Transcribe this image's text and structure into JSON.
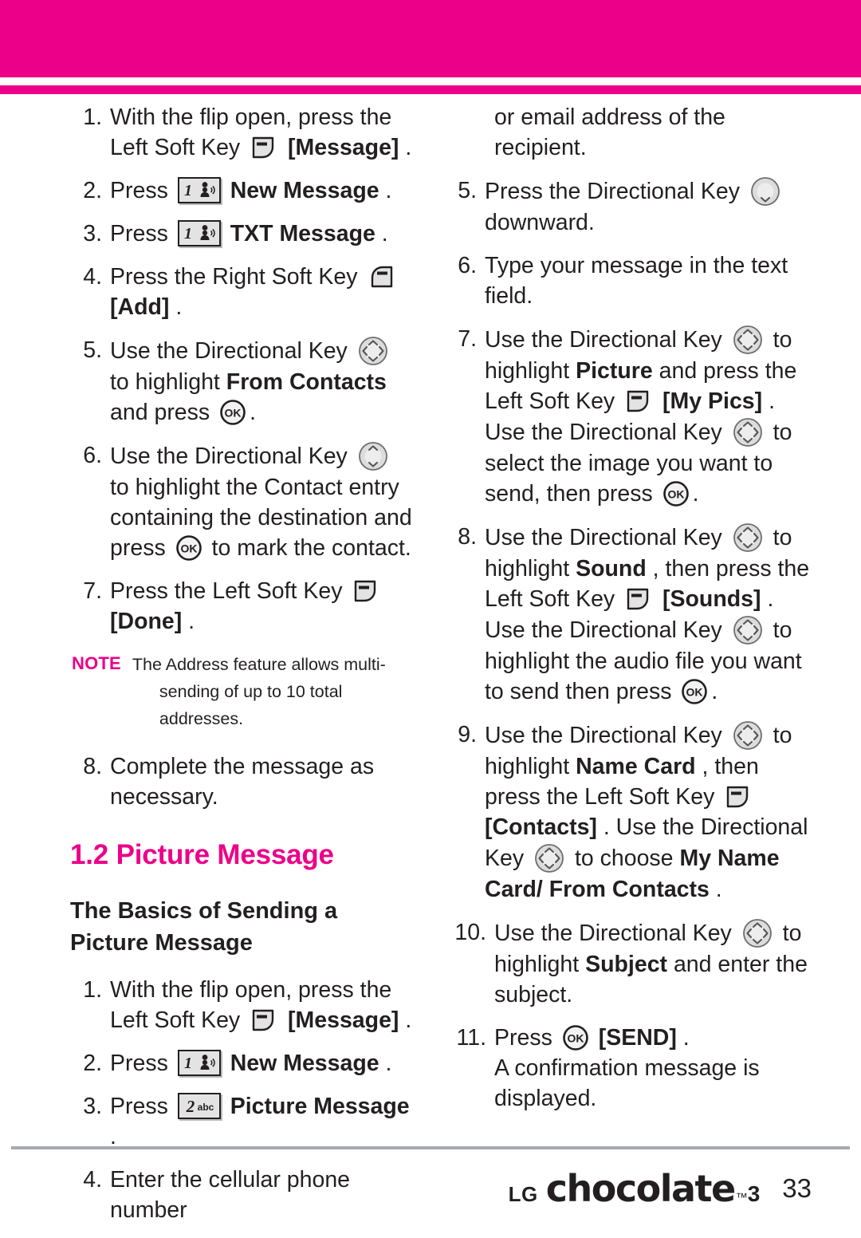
{
  "page": {
    "number": "33",
    "accent_color": "#ec0089",
    "text_color": "#231f20",
    "rule_color": "#a9aaae"
  },
  "footer": {
    "logo_lg": "LG",
    "logo_word": "chocolate",
    "logo_tm": "™",
    "logo_superscript": "3",
    "page_number": "33"
  },
  "left_column": {
    "txt_message_steps": [
      {
        "num": "1.",
        "parts": [
          {
            "t": "text",
            "v": "With the flip open, press the Left Soft Key"
          },
          {
            "t": "icon",
            "v": "left-soft-key"
          },
          {
            "t": "bold",
            "v": "[Message]"
          },
          {
            "t": "text",
            "v": "."
          }
        ]
      },
      {
        "num": "2.",
        "parts": [
          {
            "t": "text",
            "v": "Press"
          },
          {
            "t": "icon",
            "v": "key-1-voicemail"
          },
          {
            "t": "bold",
            "v": "New Message"
          },
          {
            "t": "text",
            "v": "."
          }
        ]
      },
      {
        "num": "3.",
        "parts": [
          {
            "t": "text",
            "v": "Press"
          },
          {
            "t": "icon",
            "v": "key-1-voicemail"
          },
          {
            "t": "bold",
            "v": "TXT Message"
          },
          {
            "t": "text",
            "v": "."
          }
        ]
      },
      {
        "num": "4.",
        "parts": [
          {
            "t": "text",
            "v": "Press the Right Soft Key"
          },
          {
            "t": "icon",
            "v": "right-soft-key"
          },
          {
            "t": "bold",
            "v": "[Add]"
          },
          {
            "t": "text",
            "v": "."
          }
        ]
      },
      {
        "num": "5.",
        "parts": [
          {
            "t": "text",
            "v": "Use the Directional Key"
          },
          {
            "t": "icon",
            "v": "directional-key-4way"
          },
          {
            "t": "text",
            "v": "to highlight"
          },
          {
            "t": "bold",
            "v": "From Contacts"
          },
          {
            "t": "text",
            "v": "and press"
          },
          {
            "t": "icon",
            "v": "ok-key"
          },
          {
            "t": "text",
            "v": "."
          }
        ]
      },
      {
        "num": "6.",
        "parts": [
          {
            "t": "text",
            "v": "Use the Directional Key"
          },
          {
            "t": "icon",
            "v": "directional-key-updown"
          },
          {
            "t": "text",
            "v": "to highlight the Contact entry containing the destination and press"
          },
          {
            "t": "icon",
            "v": "ok-key"
          },
          {
            "t": "text",
            "v": "to mark the contact."
          }
        ]
      },
      {
        "num": "7.",
        "parts": [
          {
            "t": "text",
            "v": "Press the Left Soft Key"
          },
          {
            "t": "icon",
            "v": "left-soft-key"
          },
          {
            "t": "bold",
            "v": "[Done]"
          },
          {
            "t": "text",
            "v": "."
          }
        ]
      }
    ],
    "note": {
      "label": "NOTE",
      "line1": "The Address feature allows multi-",
      "line2": "sending of up to 10 total addresses."
    },
    "step8": {
      "num": "8.",
      "text": "Complete the message as necessary."
    },
    "section_heading": "1.2 Picture Message",
    "sub_heading": "The Basics of Sending a Picture Message",
    "picture_message_steps": [
      {
        "num": "1.",
        "parts": [
          {
            "t": "text",
            "v": "With the flip open, press the Left Soft Key"
          },
          {
            "t": "icon",
            "v": "left-soft-key"
          },
          {
            "t": "bold",
            "v": "[Message]"
          },
          {
            "t": "text",
            "v": "."
          }
        ]
      },
      {
        "num": "2.",
        "parts": [
          {
            "t": "text",
            "v": "Press"
          },
          {
            "t": "icon",
            "v": "key-1-voicemail"
          },
          {
            "t": "bold",
            "v": "New Message"
          },
          {
            "t": "text",
            "v": "."
          }
        ]
      },
      {
        "num": "3.",
        "parts": [
          {
            "t": "text",
            "v": "Press"
          },
          {
            "t": "icon",
            "v": "key-2-abc"
          },
          {
            "t": "bold",
            "v": "Picture Message"
          },
          {
            "t": "text",
            "v": "."
          }
        ]
      },
      {
        "num": "4.",
        "parts": [
          {
            "t": "text",
            "v": "Enter the cellular phone number"
          }
        ]
      }
    ]
  },
  "right_column": {
    "continuation": "or email address of the recipient.",
    "steps": [
      {
        "num": "5.",
        "parts": [
          {
            "t": "text",
            "v": "Press the Directional Key"
          },
          {
            "t": "icon",
            "v": "directional-key-down"
          },
          {
            "t": "text",
            "v": "downward."
          }
        ]
      },
      {
        "num": "6.",
        "parts": [
          {
            "t": "text",
            "v": "Type your message in the text field."
          }
        ]
      },
      {
        "num": "7.",
        "parts": [
          {
            "t": "text",
            "v": "Use the Directional Key"
          },
          {
            "t": "icon",
            "v": "directional-key-4way"
          },
          {
            "t": "text",
            "v": "to highlight"
          },
          {
            "t": "bold",
            "v": "Picture"
          },
          {
            "t": "text",
            "v": "and press the Left Soft Key"
          },
          {
            "t": "icon",
            "v": "left-soft-key"
          },
          {
            "t": "bold",
            "v": "[My Pics]"
          },
          {
            "t": "text",
            "v": ". Use the Directional Key"
          },
          {
            "t": "icon",
            "v": "directional-key-4way"
          },
          {
            "t": "text",
            "v": "to select the image you want to send, then press"
          },
          {
            "t": "icon",
            "v": "ok-key"
          },
          {
            "t": "text",
            "v": "."
          }
        ]
      },
      {
        "num": "8.",
        "parts": [
          {
            "t": "text",
            "v": "Use the Directional Key"
          },
          {
            "t": "icon",
            "v": "directional-key-4way"
          },
          {
            "t": "text",
            "v": "to highlight"
          },
          {
            "t": "bold",
            "v": "Sound"
          },
          {
            "t": "text",
            "v": ", then press the Left Soft Key"
          },
          {
            "t": "icon",
            "v": "left-soft-key"
          },
          {
            "t": "bold",
            "v": "[Sounds]"
          },
          {
            "t": "text",
            "v": ". Use the Directional Key"
          },
          {
            "t": "icon",
            "v": "directional-key-4way"
          },
          {
            "t": "text",
            "v": "to highlight the audio file you want to send then press"
          },
          {
            "t": "icon",
            "v": "ok-key"
          },
          {
            "t": "text",
            "v": "."
          }
        ]
      },
      {
        "num": "9.",
        "parts": [
          {
            "t": "text",
            "v": "Use the Directional Key"
          },
          {
            "t": "icon",
            "v": "directional-key-4way"
          },
          {
            "t": "text",
            "v": "to highlight"
          },
          {
            "t": "bold",
            "v": "Name Card"
          },
          {
            "t": "text",
            "v": ", then press the Left Soft  Key"
          },
          {
            "t": "icon",
            "v": "left-soft-key"
          },
          {
            "t": "bold",
            "v": "[Contacts]"
          },
          {
            "t": "text",
            "v": ". Use the Directional Key"
          },
          {
            "t": "icon",
            "v": "directional-key-4way"
          },
          {
            "t": "text",
            "v": "to choose"
          },
          {
            "t": "bold",
            "v": "My Name Card/ From Contacts"
          },
          {
            "t": "text",
            "v": "."
          }
        ]
      },
      {
        "num": "10.",
        "parts": [
          {
            "t": "text",
            "v": "Use the Directional Key"
          },
          {
            "t": "icon",
            "v": "directional-key-4way"
          },
          {
            "t": "text",
            "v": "to highlight"
          },
          {
            "t": "bold",
            "v": "Subject"
          },
          {
            "t": "text",
            "v": "and enter the subject."
          }
        ]
      },
      {
        "num": "11.",
        "parts": [
          {
            "t": "text",
            "v": "Press"
          },
          {
            "t": "icon",
            "v": "ok-key"
          },
          {
            "t": "bold",
            "v": "[SEND]"
          },
          {
            "t": "text",
            "v": "."
          },
          {
            "t": "break",
            "v": ""
          },
          {
            "t": "text",
            "v": "A confirmation message is displayed."
          }
        ]
      }
    ]
  },
  "icons": {
    "left-soft-key": "left-soft-key-icon",
    "right-soft-key": "right-soft-key-icon",
    "key-1-voicemail": "keypad-1-voicemail-icon",
    "key-2-abc": "keypad-2-abc-icon",
    "ok-key": "ok-key-icon",
    "directional-key-4way": "directional-key-4way-icon",
    "directional-key-updown": "directional-key-updown-icon",
    "directional-key-down": "directional-key-down-icon"
  }
}
